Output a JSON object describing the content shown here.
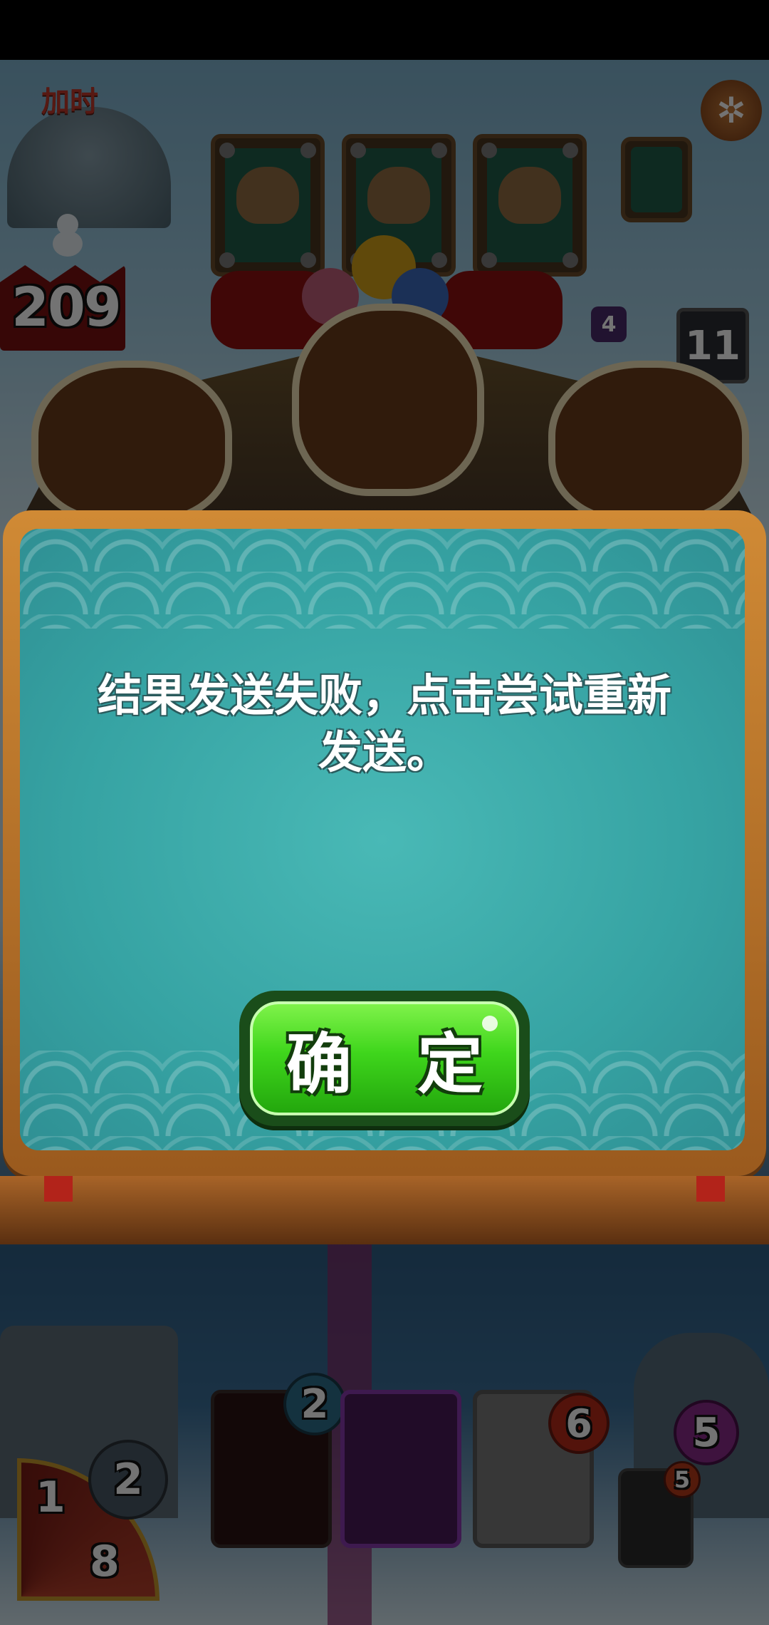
{
  "hud": {
    "add_time_label": "加时",
    "timer_value": "209"
  },
  "opponent": {
    "level_badge": "4",
    "hp_badge": "11"
  },
  "dialog": {
    "message": "结果发送失败，点击尝试重新发送。",
    "confirm_label": "确 定"
  },
  "hand": {
    "mana_top": "1",
    "mana_bottom": "8",
    "mana_shield": "2",
    "cards": [
      {
        "cost": "2"
      },
      {
        "cost": ""
      },
      {
        "cost": "6"
      },
      {
        "cost": "5"
      }
    ],
    "deck_cost": "5"
  },
  "colors": {
    "confirm_green": "#3fd61c",
    "dialog_teal": "#36a3a3",
    "frame_orange": "#d08a35"
  }
}
